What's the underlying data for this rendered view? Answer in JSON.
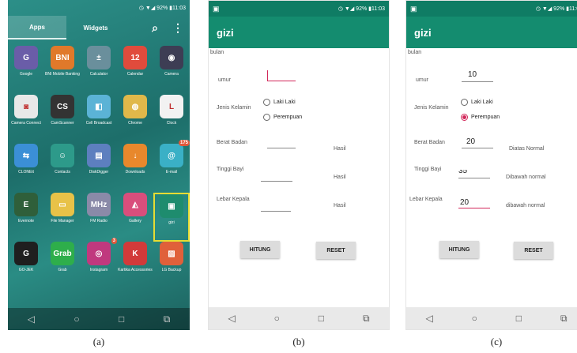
{
  "status": {
    "battery": "92%",
    "time": "11:03",
    "icons": "◷ ▼◢ 92% ▮11:03"
  },
  "launcher": {
    "tabs": [
      "Apps",
      "Widgets"
    ],
    "apps": [
      {
        "label": "Google",
        "glyph": "G",
        "color": "#6a5da8"
      },
      {
        "label": "BNI Mobile Banking",
        "glyph": "BNI",
        "color": "#e0792a"
      },
      {
        "label": "Calculator",
        "glyph": "±",
        "color": "#6a8f9c"
      },
      {
        "label": "Calendar",
        "glyph": "12",
        "color": "#e04b3c"
      },
      {
        "label": "Camera",
        "glyph": "◉",
        "color": "#3d3d54"
      },
      {
        "label": "Camera Connect",
        "glyph": "◙",
        "color": "#e8e8e8"
      },
      {
        "label": "CamScanner",
        "glyph": "CS",
        "color": "#333333"
      },
      {
        "label": "Cell Broadcast",
        "glyph": "◧",
        "color": "#5bb3d6"
      },
      {
        "label": "Chrome",
        "glyph": "◍",
        "color": "#e0b84a"
      },
      {
        "label": "Clock",
        "glyph": "L",
        "color": "#f2f2f2"
      },
      {
        "label": "CLONEit",
        "glyph": "⇆",
        "color": "#3b8fd6"
      },
      {
        "label": "Contacts",
        "glyph": "☺",
        "color": "#2d9a8a"
      },
      {
        "label": "DiskDigger",
        "glyph": "▤",
        "color": "#5d7fbf"
      },
      {
        "label": "Downloads",
        "glyph": "↓",
        "color": "#e8882c"
      },
      {
        "label": "E-mail",
        "glyph": "@",
        "color": "#3ab0c6"
      },
      {
        "label": "Evernote",
        "glyph": "E",
        "color": "#2f5f3a"
      },
      {
        "label": "File Manager",
        "glyph": "▭",
        "color": "#e8c248"
      },
      {
        "label": "FM Radio",
        "glyph": "MHz",
        "color": "#8a8aa8"
      },
      {
        "label": "Gallery",
        "glyph": "◭",
        "color": "#d94e7c"
      },
      {
        "label": "gizi",
        "glyph": "▣",
        "color": "#1e8c6e"
      },
      {
        "label": "GO-JEK",
        "glyph": "G",
        "color": "#1f1f1f"
      },
      {
        "label": "Grab",
        "glyph": "Grab",
        "color": "#2eae4b"
      },
      {
        "label": "Instagram",
        "glyph": "◎",
        "color": "#c0397e"
      },
      {
        "label": "Kartika Accessories",
        "glyph": "K",
        "color": "#d23a3a"
      },
      {
        "label": "LG Backup",
        "glyph": "▨",
        "color": "#e0603a"
      }
    ],
    "badges": {
      "email": "175",
      "instagram": "3"
    },
    "highlight_color": "#e6dc33"
  },
  "form": {
    "app_title": "gizi",
    "bulan": "bulan",
    "umur": "umur",
    "jenis_kelamin": "Jenis Kelamin",
    "laki": "Laki Laki",
    "perempuan": "Perempuan",
    "berat": "Berat Badan",
    "tinggi": "Tinggi Bayi",
    "lebar": "Lebar Kepala",
    "hasil": "Hasil",
    "hitung": "HITUNG",
    "reset": "RESET"
  },
  "filled": {
    "umur": "10",
    "berat": "20",
    "tinggi": "35",
    "lebar": "20",
    "hasil_berat": "Diatas Normal",
    "hasil_tinggi": "Dibawah normal",
    "hasil_lebar": "dibawah normal"
  },
  "captions": [
    "(a)",
    "(b)",
    "(c)"
  ],
  "colors": {
    "appbar": "#148c6f",
    "statusbar": "#0f7c64",
    "accent": "#d2285a"
  }
}
